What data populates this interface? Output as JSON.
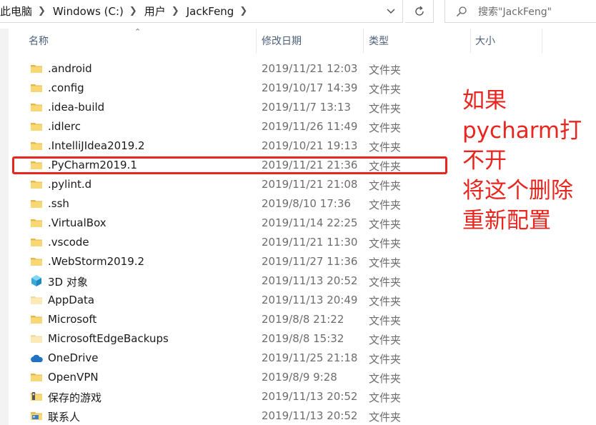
{
  "breadcrumb": {
    "items": [
      "此电脑",
      "Windows (C:)",
      "用户",
      "JackFeng"
    ]
  },
  "search": {
    "placeholder": "搜索\"JackFeng\""
  },
  "columns": {
    "name": "名称",
    "date": "修改日期",
    "type": "类型",
    "size": "大小"
  },
  "rows": [
    {
      "icon": "folder-icon",
      "name": ".android",
      "date": "2019/11/21 12:03",
      "type": "文件夹"
    },
    {
      "icon": "folder-icon",
      "name": ".config",
      "date": "2019/10/17 14:39",
      "type": "文件夹"
    },
    {
      "icon": "folder-icon",
      "name": ".idea-build",
      "date": "2019/11/7 13:13",
      "type": "文件夹"
    },
    {
      "icon": "folder-icon",
      "name": ".idlerc",
      "date": "2019/11/26 11:49",
      "type": "文件夹"
    },
    {
      "icon": "folder-icon",
      "name": ".IntelliJIdea2019.2",
      "date": "2019/10/21 19:13",
      "type": "文件夹"
    },
    {
      "icon": "folder-icon",
      "name": ".PyCharm2019.1",
      "date": "2019/11/21 21:36",
      "type": "文件夹"
    },
    {
      "icon": "folder-icon",
      "name": ".pylint.d",
      "date": "2019/11/21 21:08",
      "type": "文件夹"
    },
    {
      "icon": "folder-icon",
      "name": ".ssh",
      "date": "2019/8/10 17:36",
      "type": "文件夹"
    },
    {
      "icon": "folder-icon",
      "name": ".VirtualBox",
      "date": "2019/11/14 22:25",
      "type": "文件夹"
    },
    {
      "icon": "folder-icon",
      "name": ".vscode",
      "date": "2019/11/21 11:30",
      "type": "文件夹"
    },
    {
      "icon": "folder-icon",
      "name": ".WebStorm2019.2",
      "date": "2019/11/27 11:36",
      "type": "文件夹"
    },
    {
      "icon": "3d-objects-icon",
      "name": "3D 对象",
      "date": "2019/11/13 20:52",
      "type": "文件夹"
    },
    {
      "icon": "folder-faded-icon",
      "name": "AppData",
      "date": "2019/11/13 20:49",
      "type": "文件夹"
    },
    {
      "icon": "folder-icon",
      "name": "Microsoft",
      "date": "2019/8/8 21:22",
      "type": "文件夹"
    },
    {
      "icon": "folder-faded-icon",
      "name": "MicrosoftEdgeBackups",
      "date": "2019/8/8 15:32",
      "type": "文件夹"
    },
    {
      "icon": "onedrive-icon",
      "name": "OneDrive",
      "date": "2019/11/25 21:18",
      "type": "文件夹"
    },
    {
      "icon": "folder-icon",
      "name": "OpenVPN",
      "date": "2019/8/9 9:28",
      "type": "文件夹"
    },
    {
      "icon": "saved-games-icon",
      "name": "保存的游戏",
      "date": "2019/11/13 20:52",
      "type": "文件夹"
    },
    {
      "icon": "contacts-icon",
      "name": "联系人",
      "date": "2019/11/13 20:52",
      "type": "文件夹"
    }
  ],
  "annotation": {
    "lines": [
      "如果",
      "pycharm打",
      "不开",
      "将这个删除",
      "重新配置"
    ],
    "color": "#e8261f"
  },
  "colors": {
    "folder": "#f8d775",
    "folder_dark": "#e6b84a",
    "header_text": "#4c607a"
  }
}
